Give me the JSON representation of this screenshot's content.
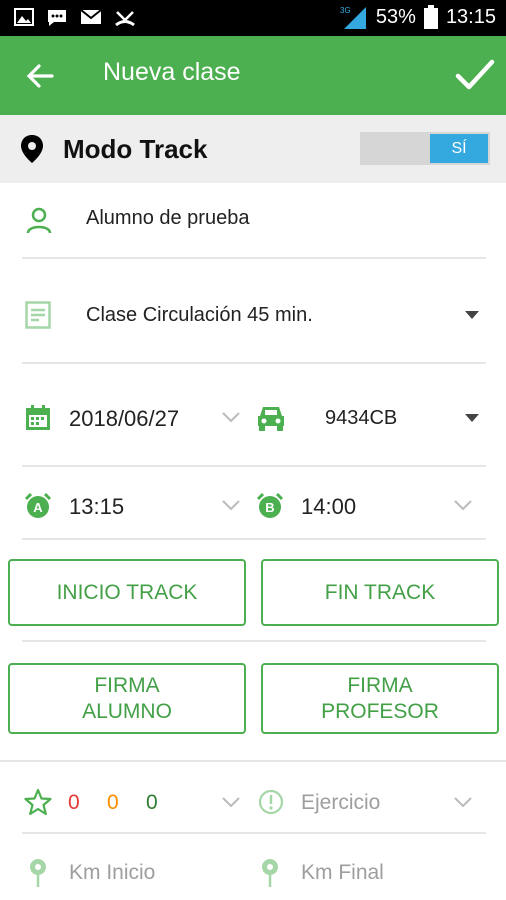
{
  "status_bar": {
    "battery": "53%",
    "time": "13:15",
    "network": "3G"
  },
  "header": {
    "title": "Nueva clase",
    "back_icon": "arrow-left-icon",
    "confirm_icon": "check-icon"
  },
  "track_mode": {
    "label": "Modo Track",
    "toggle_value": "SÍ"
  },
  "form": {
    "student": "Alumno de prueba",
    "class_type": "Clase Circulación 45 min.",
    "date": "2018/06/27",
    "vehicle": "9434CB",
    "start_time": "13:15",
    "end_time": "14:00"
  },
  "buttons": {
    "start_track": "INICIO TRACK",
    "end_track": "FIN TRACK",
    "sign_student_line1": "FIRMA",
    "sign_student_line2": "ALUMNO",
    "sign_teacher_line1": "FIRMA",
    "sign_teacher_line2": "PROFESOR"
  },
  "rating": {
    "red": "0",
    "orange": "0",
    "green": "0",
    "exercise_placeholder": "Ejercicio"
  },
  "km": {
    "start_placeholder": "Km Inicio",
    "end_placeholder": "Km Final"
  },
  "colors": {
    "primary": "#4caf50",
    "toggle_on": "#33a9df",
    "red": "#e53935",
    "orange": "#fb8c00",
    "green": "#2e7d32"
  }
}
